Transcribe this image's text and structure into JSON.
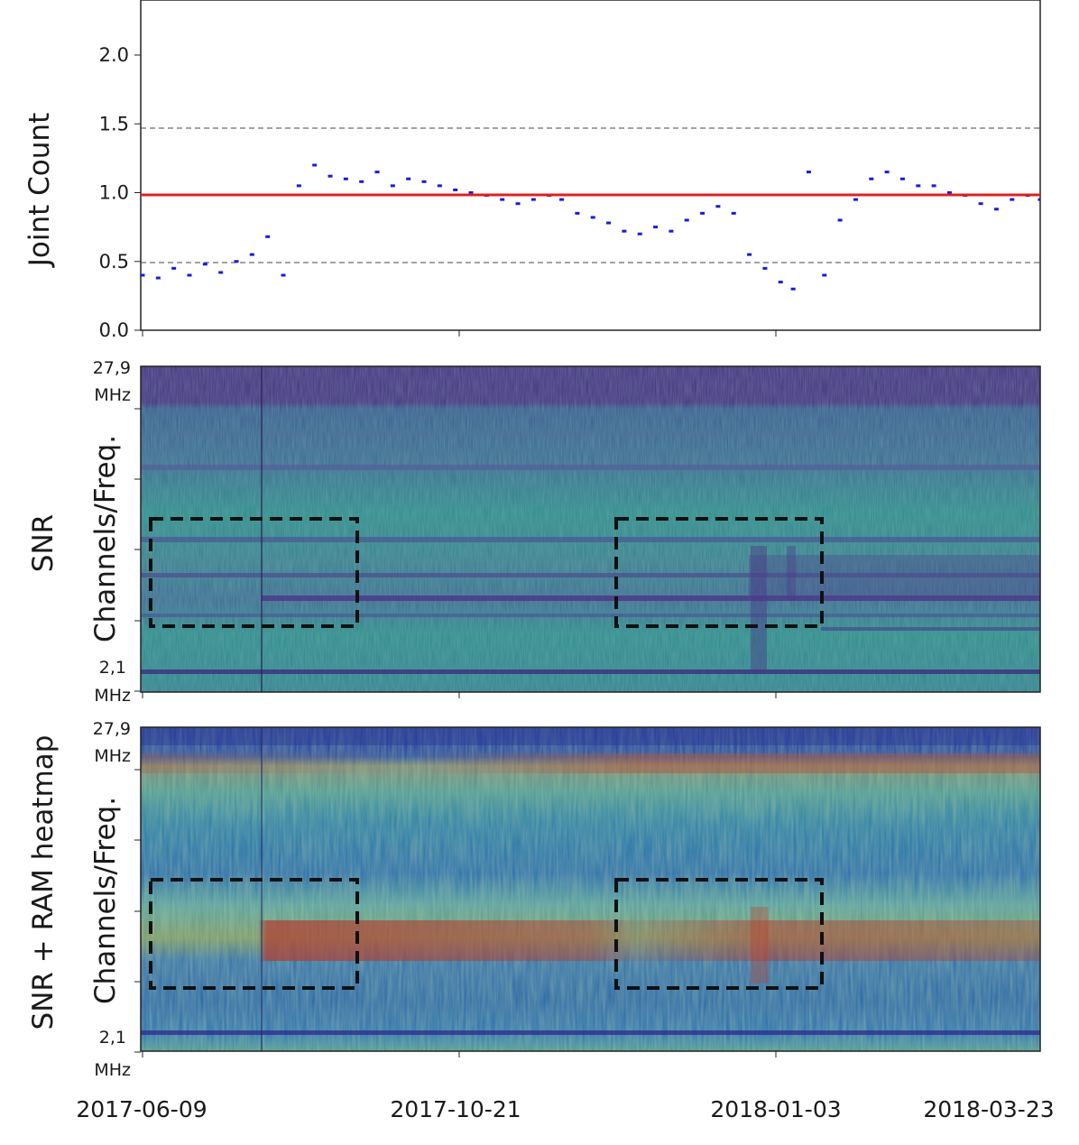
{
  "chart_data": [
    {
      "type": "scatter",
      "ylabel": "Joint Count",
      "ylim": [
        0,
        2.4
      ],
      "yticks": [
        "0.0",
        "0.5",
        "1.0",
        "1.5",
        "2.0"
      ],
      "reference_lines": {
        "solid_red": 1.0,
        "dashed": [
          0.5,
          1.5
        ]
      },
      "x": [
        "2017-06-09",
        "2017-06-14",
        "2017-06-19",
        "2017-06-24",
        "2017-06-29",
        "2017-07-04",
        "2017-07-09",
        "2017-07-14",
        "2017-07-19",
        "2017-07-24",
        "2017-07-29",
        "2017-08-03",
        "2017-08-08",
        "2017-08-13",
        "2017-08-18",
        "2017-08-23",
        "2017-08-28",
        "2017-09-02",
        "2017-09-07",
        "2017-09-12",
        "2017-09-17",
        "2017-09-22",
        "2017-09-27",
        "2017-10-02",
        "2017-10-07",
        "2017-10-12",
        "2017-10-17",
        "2017-10-21",
        "2017-10-26",
        "2017-10-31",
        "2017-11-05",
        "2017-11-10",
        "2017-11-15",
        "2017-11-20",
        "2017-11-25",
        "2017-11-30",
        "2017-12-05",
        "2017-12-10",
        "2017-12-15",
        "2017-12-20",
        "2017-12-25",
        "2017-12-30",
        "2018-01-03",
        "2018-01-08",
        "2018-01-13",
        "2018-01-18",
        "2018-01-23",
        "2018-01-28",
        "2018-02-02",
        "2018-02-07",
        "2018-02-12",
        "2018-02-17",
        "2018-02-22",
        "2018-02-27",
        "2018-03-04",
        "2018-03-09",
        "2018-03-14",
        "2018-03-19",
        "2018-03-23"
      ],
      "y": [
        0.4,
        0.38,
        0.45,
        0.4,
        0.48,
        0.42,
        0.5,
        0.55,
        0.68,
        0.4,
        1.05,
        1.2,
        1.12,
        1.1,
        1.08,
        1.15,
        1.05,
        1.1,
        1.08,
        1.05,
        1.02,
        1.0,
        0.98,
        0.95,
        0.92,
        0.95,
        0.98,
        0.95,
        0.85,
        0.82,
        0.78,
        0.72,
        0.7,
        0.75,
        0.72,
        0.8,
        0.85,
        0.9,
        0.85,
        0.55,
        0.45,
        0.35,
        0.3,
        1.15,
        0.4,
        0.8,
        0.95,
        1.1,
        1.15,
        1.1,
        1.05,
        1.05,
        1.0,
        0.98,
        0.92,
        0.88,
        0.95,
        0.98,
        0.95
      ]
    },
    {
      "type": "heatmap",
      "title": "SNR",
      "ylabel": "Channels/Freq.",
      "ytick_top": [
        "27,9",
        "MHz"
      ],
      "ytick_bottom": [
        "2,1",
        "MHz"
      ],
      "highlight_boxes": [
        {
          "x_start": "2017-06-13",
          "x_end": "2017-08-29"
        },
        {
          "x_start": "2017-11-25",
          "x_end": "2018-01-19"
        }
      ]
    },
    {
      "type": "heatmap",
      "title": "SNR + RAM heatmap",
      "ylabel": "Channels/Freq.",
      "ytick_top": [
        "27,9",
        "MHz"
      ],
      "ytick_bottom": [
        "2,1",
        "MHz"
      ],
      "highlight_boxes": [
        {
          "x_start": "2017-06-13",
          "x_end": "2017-08-29"
        },
        {
          "x_start": "2017-11-25",
          "x_end": "2018-01-19"
        }
      ]
    }
  ],
  "x_tick_labels": [
    "2017-06-09",
    "2017-10-21",
    "2018-01-03",
    "2018-03-23"
  ],
  "colors": {
    "points": "#1a1ae0",
    "reference": "#e02020",
    "snr_base": "#3b6e95",
    "snr_dark": "#4a2d84",
    "ram_red": "#b23a30"
  }
}
